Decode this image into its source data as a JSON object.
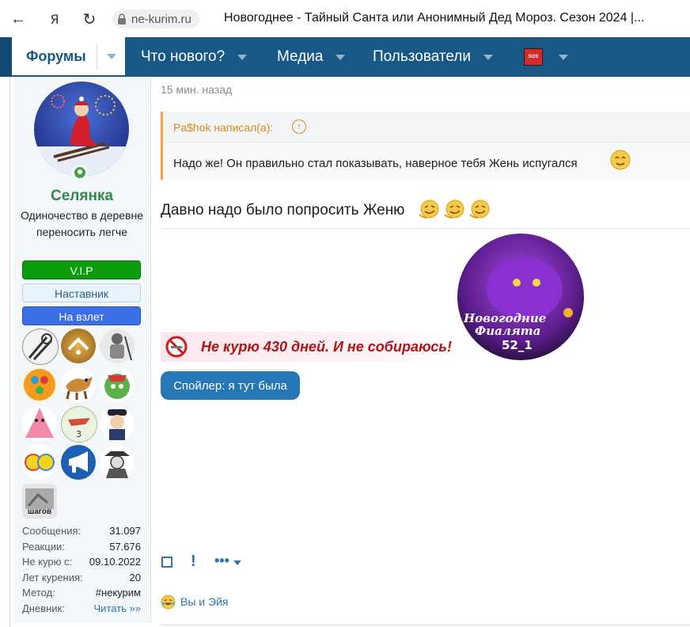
{
  "browser": {
    "url": "ne-kurim.ru",
    "title": "Новогоднее - Тайный Санта или Анонимный Дед Мороз. Сезон 2024 |...",
    "back_icon": "←",
    "yandex_icon": "Я",
    "reload_icon": "↻"
  },
  "nav": {
    "active_tab": "Форумы",
    "items": [
      {
        "label": "Что нового?"
      },
      {
        "label": "Медиа"
      },
      {
        "label": "Пользователи"
      }
    ],
    "sos_label": "SOS"
  },
  "user": {
    "name": "Селянка",
    "title": "Одиночество в деревне переносить легче",
    "banners": {
      "vip": "V.I.P",
      "mentor": "Наставник",
      "takeoff": "На взлет"
    },
    "award_caption": "шагов",
    "stats": [
      {
        "key": "Сообщения:",
        "value": "31.097"
      },
      {
        "key": "Реакции:",
        "value": "57.676"
      },
      {
        "key": "Не курю с:",
        "value": "09.10.2022"
      },
      {
        "key": "Лет курения:",
        "value": "20"
      },
      {
        "key": "Метод:",
        "value": "#некурим"
      },
      {
        "key": "Дневник:",
        "value": "Читать »»"
      }
    ]
  },
  "post": {
    "time": "15 мин. назад",
    "quote_author": "Pa$hok написал(а):",
    "quote_text": "Надо же! Он правильно стал показывать, наверное тебя Жень испугался",
    "body": "Давно надо было попросить Женю",
    "signature_no_smoke": "Не курю 430 дней. И не собираюсь!",
    "signature_image_text": {
      "line1": "Новогодние",
      "line2": "Фиалята",
      "number": "52_1"
    },
    "spoiler_label": "Спойлер: я тут была",
    "actions": {
      "report": "!",
      "more": "•••"
    },
    "reactions_text": "Вы и Эйя"
  },
  "colors": {
    "nav_bg": "#185886",
    "username": "#2c8a4d",
    "vip": "#0c9c0c",
    "takeoff": "#3c6ee6",
    "link": "#2f73ad",
    "quote_accent": "#f0a640"
  }
}
